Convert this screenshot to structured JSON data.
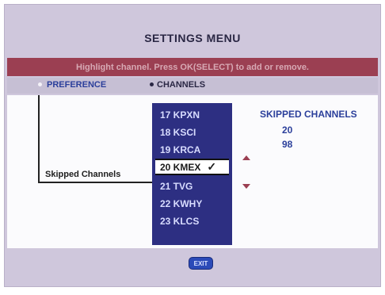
{
  "menu": {
    "title": "SETTINGS MENU",
    "instruction": "Highlight channel. Press OK(SELECT) to add or remove.",
    "tabs": [
      {
        "label": "PREFERENCE"
      },
      {
        "label": "CHANNELS"
      }
    ],
    "skip_label": "Skipped Channels",
    "channels": [
      {
        "label": "17 KPXN"
      },
      {
        "label": "18 KSCI"
      },
      {
        "label": "19 KRCA"
      },
      {
        "label": "20 KMEX",
        "mark": "✓"
      },
      {
        "label": "21 TVG"
      },
      {
        "label": "22 KWHY"
      },
      {
        "label": "23 KLCS"
      }
    ],
    "skipped": {
      "header": "SKIPPED CHANNELS",
      "items": [
        "20",
        "98"
      ]
    },
    "exit_label": "EXIT"
  },
  "colors": {
    "background": "#cfc7dc",
    "banner": "#9b3f52",
    "list": "#2d2f82",
    "accent": "#2b3f9b"
  },
  "icons": {
    "up": "arrow-up-icon",
    "down": "arrow-down-icon",
    "check": "checkmark-icon"
  }
}
